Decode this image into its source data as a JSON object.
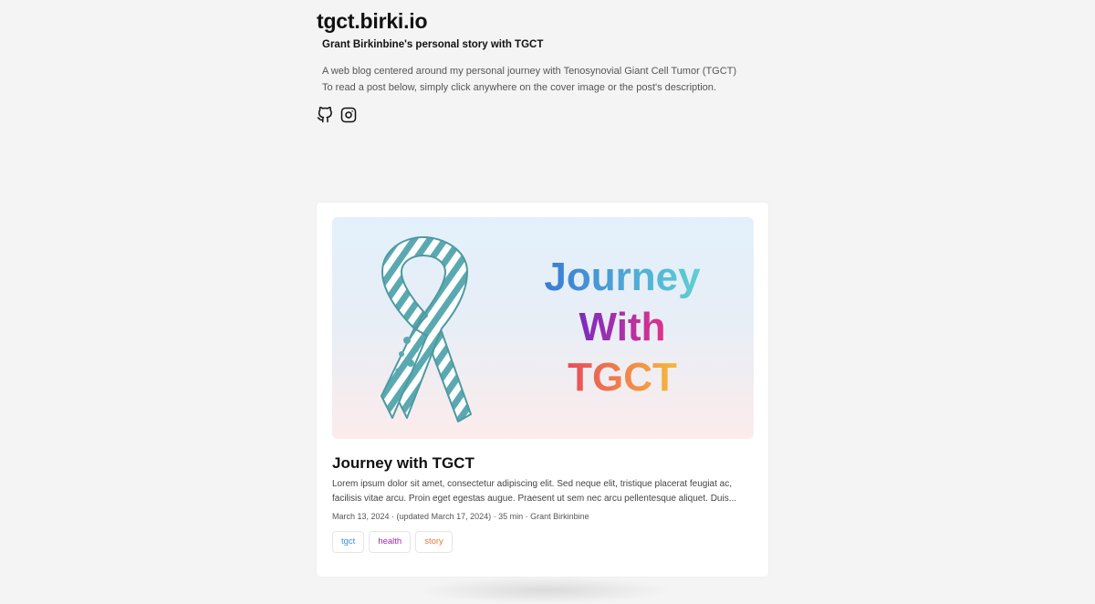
{
  "header": {
    "site_title": "tgct.birki.io",
    "tagline": "Grant Birkinbine's personal story with TGCT",
    "description_line1": "A web blog centered around my personal journey with Tenosynovial Giant Cell Tumor (TGCT)",
    "description_line2": "To read a post below, simply click anywhere on the cover image or the post's description."
  },
  "socials": [
    {
      "icon": "github-icon"
    },
    {
      "icon": "instagram-icon"
    }
  ],
  "post": {
    "cover_text": {
      "line1": "Journey",
      "line2": "With",
      "line3": "TGCT"
    },
    "title": "Journey with TGCT",
    "excerpt_line1": "Lorem ipsum dolor sit amet, consectetur adipiscing elit. Sed neque elit, tristique placerat feugiat ac,",
    "excerpt_line2": "facilisis vitae arcu. Proin eget egestas augue. Praesent ut sem nec arcu pellentesque aliquet. Duis...",
    "meta": "March 13, 2024 · (updated March 17, 2024) · 35 min · Grant Birkinbine",
    "tags": [
      {
        "label": "tgct",
        "color": "#3a8fd6"
      },
      {
        "label": "health",
        "color": "#9b2ba6"
      },
      {
        "label": "story",
        "color": "#e07b3c"
      }
    ]
  },
  "colors": {
    "page_bg": "#f4f4f4",
    "ribbon": "#5aa9b0",
    "journey_gradient": [
      "#3a7bd5",
      "#5fd0d3"
    ],
    "with_gradient": [
      "#7b2cbf",
      "#e0338a"
    ],
    "tgct_gradient": [
      "#e74c5b",
      "#f6b93b"
    ]
  }
}
